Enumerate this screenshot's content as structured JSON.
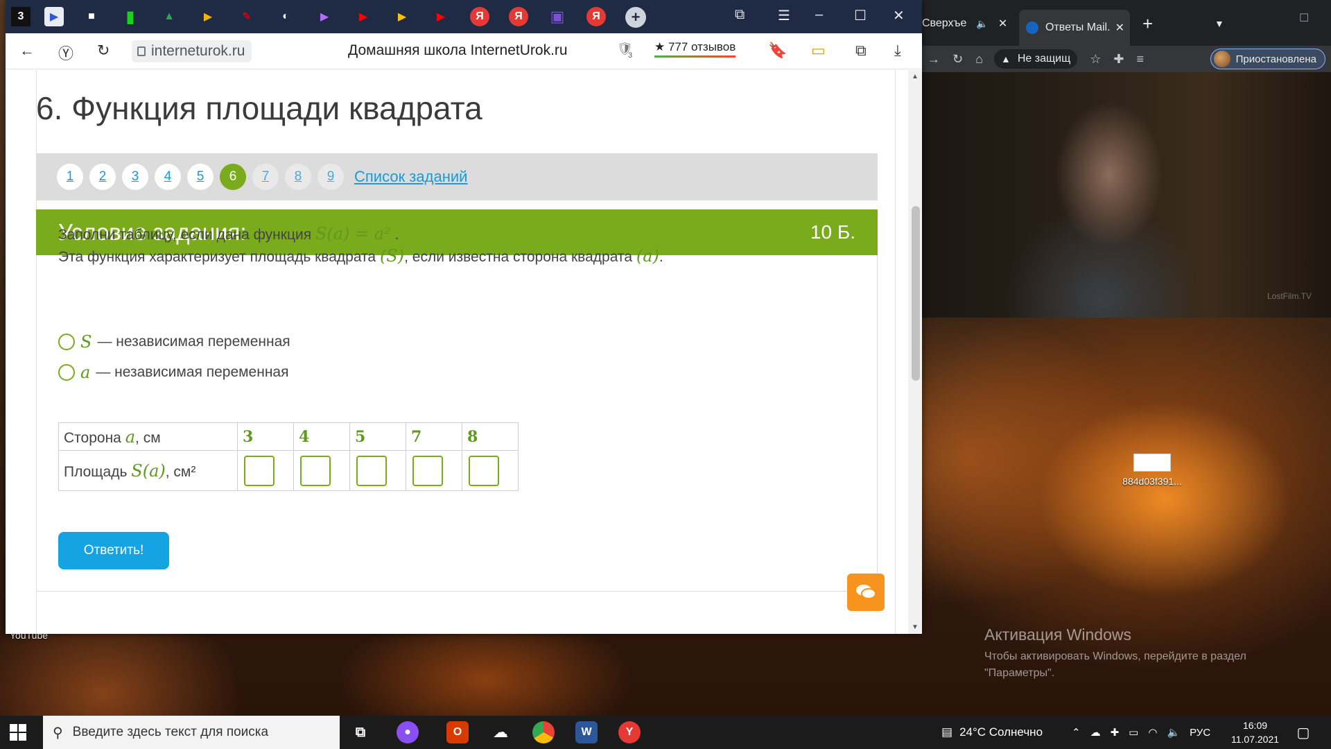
{
  "browser": {
    "tab_icons": [
      "3",
      "▶",
      "■",
      "▮",
      "▲",
      "▶",
      "✎",
      "◐",
      "▶",
      "▶",
      "▶",
      "▶",
      "Я",
      "Я",
      "▣",
      "Я"
    ],
    "new_tab": "+",
    "url": "interneturok.ru",
    "page_title": "Домашняя школа InternetUrok.ru",
    "reviews": "★ 777 отзывов",
    "ext_badge": "3",
    "page": {
      "heading": "6. Функция площади квадрата",
      "pager": [
        "1",
        "2",
        "3",
        "4",
        "5",
        "6",
        "7",
        "8",
        "9"
      ],
      "pager_active": "6",
      "task_list_link": "Список заданий",
      "task_header": "Условие задания:",
      "points": "10 Б.",
      "line1_text": "Заполни таблицу, если дана функция",
      "line1_math": "S(a) = a²",
      "line1_end": ".",
      "line2_a": "Эта функция характеризует площадь квадрата",
      "line2_m1": "(S)",
      "line2_b": ", если известна сторона квадрата",
      "line2_m2": "(a)",
      "line2_end": ".",
      "option1_var": "S",
      "option1_text": "— независимая переменная",
      "option2_var": "a",
      "option2_text": "— независимая переменная",
      "table": {
        "row1_label_a": "Сторона",
        "row1_var": "a",
        "row1_label_b": ", см",
        "row2_label_a": "Площадь",
        "row2_var": "S(a)",
        "row2_label_b": ", см²",
        "values": [
          "3",
          "4",
          "5",
          "7",
          "8"
        ]
      },
      "submit": "Ответить!"
    }
  },
  "right_browser": {
    "tab1": "Сверхъе",
    "tab2": "Ответы Mail.",
    "address": "Не защищ",
    "profile": "Приостановлена",
    "video_watermark": "LostFilm.TV"
  },
  "desktop": {
    "youtube_label": "YouTube",
    "file_label": "884d03f391...",
    "activation_title": "Активация Windows",
    "activation_text1": "Чтобы активировать Windows, перейдите в раздел",
    "activation_text2": "\"Параметры\"."
  },
  "taskbar": {
    "search_placeholder": "Введите здесь текст для поиска",
    "weather": "24°C  Солнечно",
    "lang": "РУС",
    "time": "16:09",
    "date": "11.07.2021"
  }
}
